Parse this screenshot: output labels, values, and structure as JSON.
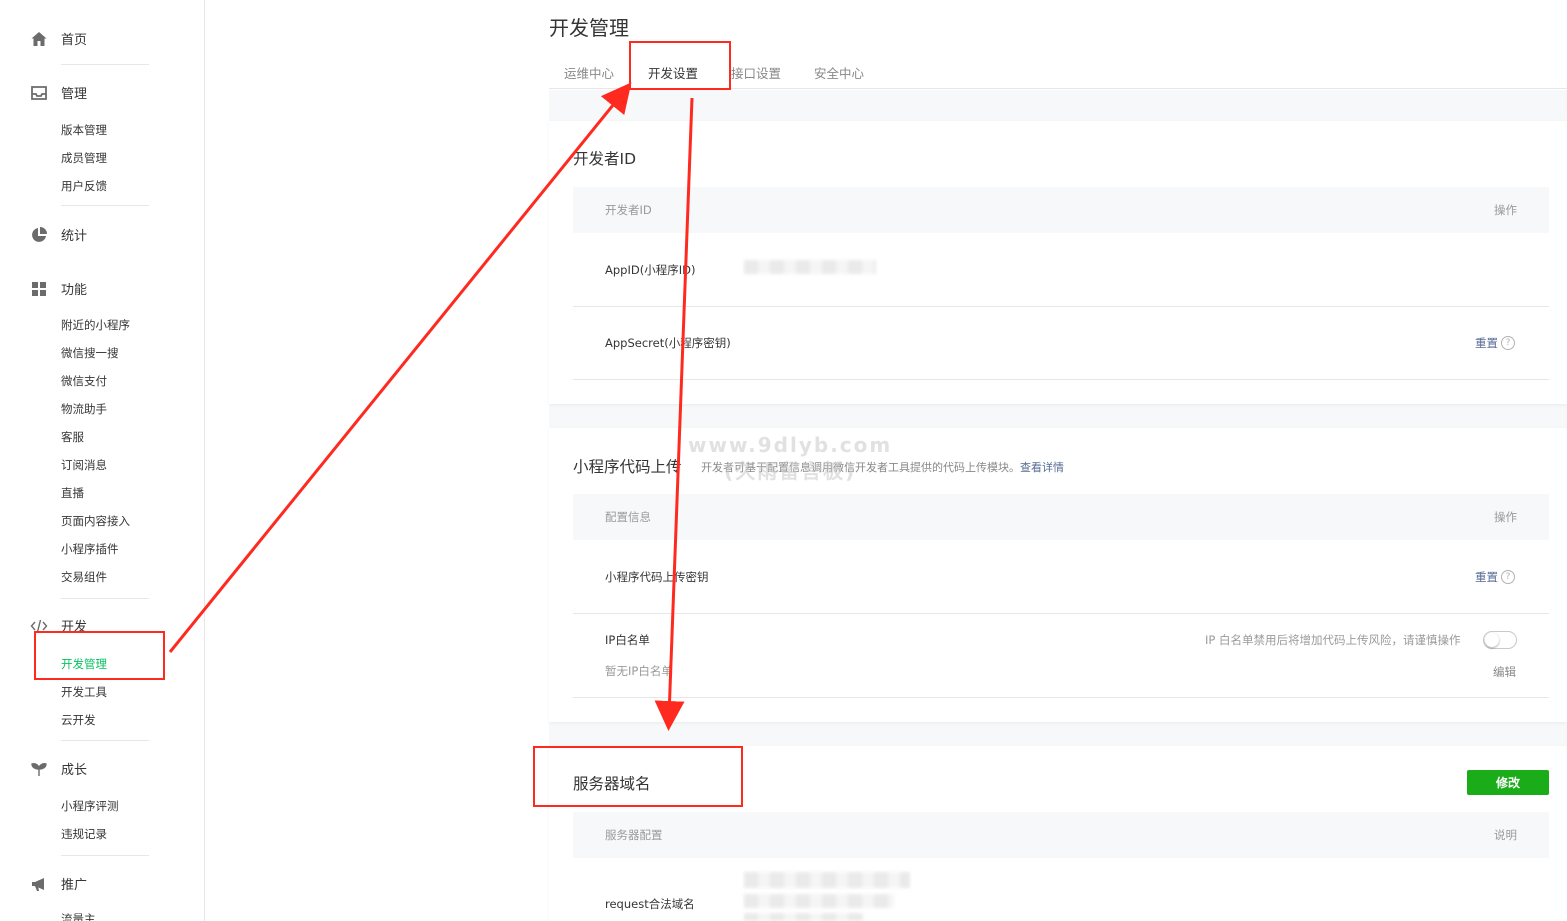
{
  "sidebar": {
    "home": "首页",
    "manage": "管理",
    "manage_items": [
      "版本管理",
      "成员管理",
      "用户反馈"
    ],
    "stats": "统计",
    "features": "功能",
    "feature_items": [
      "附近的小程序",
      "微信搜一搜",
      "微信支付",
      "物流助手",
      "客服",
      "订阅消息",
      "直播",
      "页面内容接入",
      "小程序插件",
      "交易组件"
    ],
    "dev": "开发",
    "dev_items": [
      "开发管理",
      "开发工具",
      "云开发"
    ],
    "growth": "成长",
    "growth_items": [
      "小程序评测",
      "违规记录"
    ],
    "promote": "推广",
    "promote_partial": "流量主"
  },
  "header": {
    "title": "开发管理",
    "tabs": [
      "运维中心",
      "开发设置",
      "接口设置",
      "安全中心"
    ],
    "active_tab": "开发设置"
  },
  "developer_id": {
    "title": "开发者ID",
    "col_left": "开发者ID",
    "col_right": "操作",
    "appid_label": "AppID(小程序ID)",
    "appsecret_label": "AppSecret(小程序密钥)",
    "reset": "重置",
    "help": "?"
  },
  "code_upload": {
    "title": "小程序代码上传",
    "desc": "开发者可基于配置信息调用微信开发者工具提供的代码上传模块。",
    "desc_link": "查看详情",
    "col_left": "配置信息",
    "col_right": "操作",
    "key_label": "小程序代码上传密钥",
    "reset": "重置",
    "ip_label": "IP白名单",
    "ip_warning": "IP 白名单禁用后将增加代码上传风险，请谨慎操作",
    "ip_toggle_on": false,
    "ip_empty": "暂无IP白名单",
    "edit": "编辑"
  },
  "server_domain": {
    "title": "服务器域名",
    "modify": "修改",
    "col_left": "服务器配置",
    "col_right": "说明",
    "request_label": "request合法域名"
  },
  "watermark": {
    "line1": "www.9dlyb.com",
    "line2": "(久雨留言板)"
  },
  "colors": {
    "accent_green": "#1aad19",
    "active_nav": "#07c160",
    "link": "#576b95",
    "annotation_red": "#ff2a1f"
  }
}
